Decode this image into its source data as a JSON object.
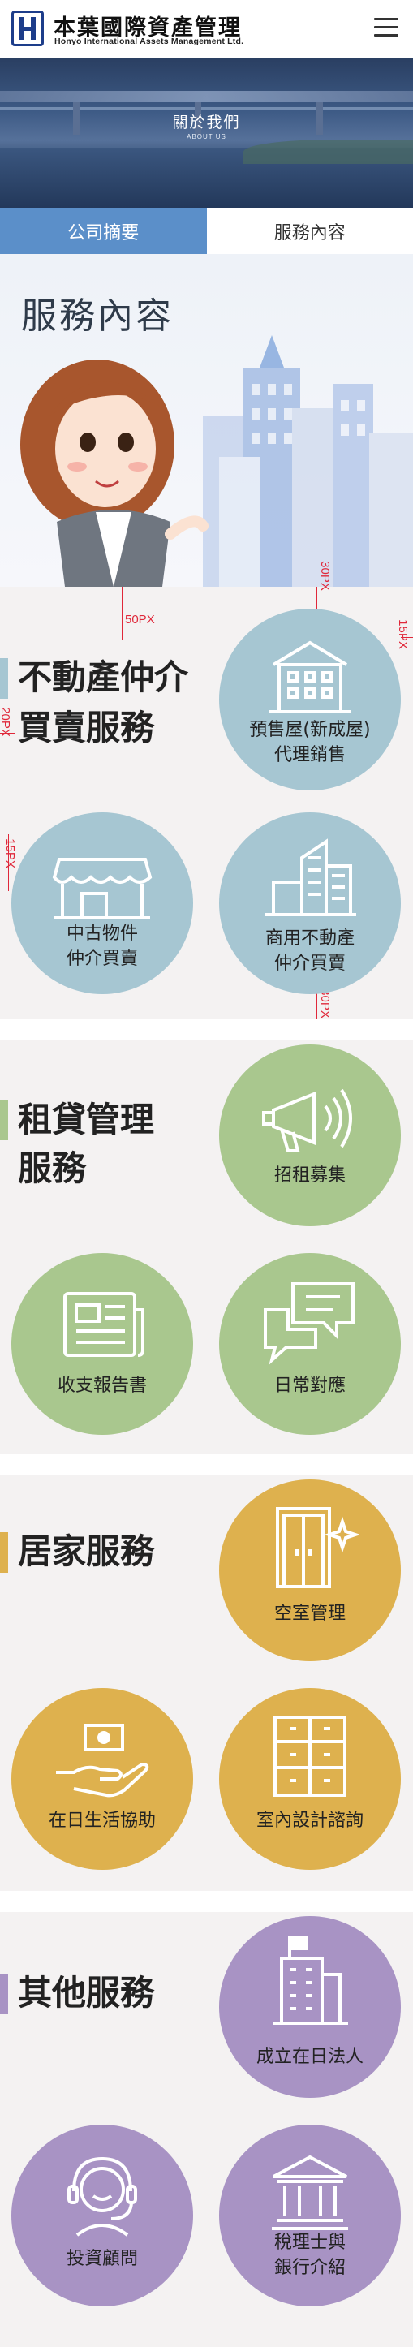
{
  "header": {
    "brand_zh": "本葉國際資產管理",
    "brand_en": "Honyo International Assets Management Ltd.",
    "menu_icon": "hamburger-icon"
  },
  "banner": {
    "title": "關於我們",
    "subtitle": "ABOUT US"
  },
  "tabs": [
    {
      "label": "公司摘要",
      "active": true
    },
    {
      "label": "服務內容",
      "active": false
    }
  ],
  "hero": {
    "title": "服務內容"
  },
  "measurements": {
    "m1": "50PX",
    "m2": "30PX",
    "m3": "15PX",
    "m4": "20PX",
    "m5": "15PX",
    "m6": "30PX"
  },
  "sections": {
    "real_estate": {
      "title_line1": "不動產仲介",
      "title_line2": "買賣服務",
      "color": "#a6c6d2",
      "bar_color": "#a6c6d2",
      "items": [
        {
          "line1": "預售屋(新成屋)",
          "line2": "代理銷售",
          "icon": "building-icon"
        },
        {
          "line1": "中古物件",
          "line2": "仲介買賣",
          "icon": "shop-icon"
        },
        {
          "line1": "商用不動產",
          "line2": "仲介買賣",
          "icon": "city-icon"
        }
      ]
    },
    "rental": {
      "title_line1": "租貸管理",
      "title_line2": "服務",
      "color": "#a9c78e",
      "bar_color": "#a9c78e",
      "items": [
        {
          "line1": "招租募集",
          "icon": "megaphone-icon"
        },
        {
          "line1": "收支報告書",
          "icon": "newspaper-icon"
        },
        {
          "line1": "日常對應",
          "icon": "chat-icon"
        }
      ]
    },
    "home": {
      "title_line1": "居家服務",
      "color": "#deb14e",
      "bar_color": "#deb14e",
      "items": [
        {
          "line1": "空室管理",
          "icon": "door-icon"
        },
        {
          "line1": "在日生活協助",
          "icon": "hand-money-icon"
        },
        {
          "line1": "室內設計諮詢",
          "icon": "cabinet-icon"
        }
      ]
    },
    "other": {
      "title_line1": "其他服務",
      "color": "#a893c4",
      "bar_color": "#a893c4",
      "items": [
        {
          "line1": "成立在日法人",
          "icon": "office-building-icon"
        },
        {
          "line1": "投資顧問",
          "icon": "headset-icon"
        },
        {
          "line1": "稅理士與",
          "line2": "銀行介紹",
          "icon": "bank-icon"
        }
      ]
    }
  }
}
